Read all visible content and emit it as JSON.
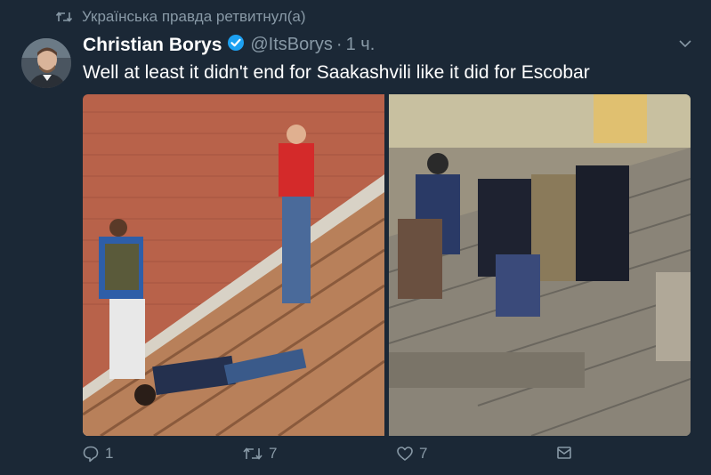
{
  "retweet_notice": {
    "icon": "retweet-icon",
    "text": "Українська правда ретвитнул(а)"
  },
  "tweet": {
    "author_name": "Christian Borys",
    "verified_icon": "verified-badge-icon",
    "handle": "@ItsBorys",
    "separator": "·",
    "time": "1 ч.",
    "menu_icon": "chevron-down-icon",
    "text": "Well at least it didn't end for Saakashvili like it did for Escobar",
    "media": [
      {
        "name": "escobar-rooftop-photo"
      },
      {
        "name": "saakashvili-rooftop-photo"
      }
    ]
  },
  "actions": {
    "reply": {
      "icon": "reply-icon",
      "count": "1"
    },
    "retweet": {
      "icon": "retweet-icon",
      "count": "7"
    },
    "like": {
      "icon": "heart-icon",
      "count": "7"
    },
    "dm": {
      "icon": "envelope-icon"
    }
  },
  "colors": {
    "background": "#1b2836",
    "secondary_text": "#8899a6",
    "verified_badge": "#1da1f2"
  }
}
